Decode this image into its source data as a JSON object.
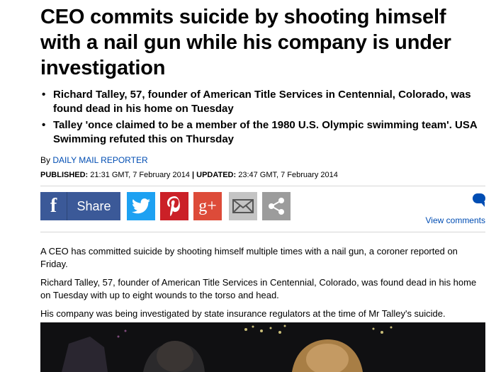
{
  "article": {
    "headline": "CEO commits suicide by shooting himself with a nail gun while his company is under investigation",
    "bullets": [
      "Richard Talley, 57, founder of American Title Services in Centennial, Colorado, was found dead in his home on Tuesday",
      "Talley 'once claimed to be a member of the 1980 U.S. Olympic swimming team'. USA Swimming refuted this on Thursday"
    ],
    "byline_prefix": "By",
    "author": "DAILY MAIL REPORTER",
    "published_label": "PUBLISHED:",
    "published_value": "21:31 GMT, 7 February 2014",
    "separator": "|",
    "updated_label": "UPDATED:",
    "updated_value": "23:47 GMT, 7 February 2014",
    "paragraphs": [
      "A CEO has committed suicide by shooting himself multiple times with a nail gun, a coroner reported on Friday.",
      "Richard Talley, 57, founder of American Title Services in Centennial, Colorado, was found dead in his home on Tuesday with up to eight wounds to the torso and head.",
      "His company was being investigated by state insurance regulators at the time of Mr Talley's suicide."
    ]
  },
  "share": {
    "facebook_label": "Share",
    "facebook_glyph": "f",
    "gplus_glyph": "g+",
    "icons": [
      "facebook-icon",
      "twitter-icon",
      "pinterest-icon",
      "google-plus-icon",
      "email-icon",
      "share-more-icon",
      "comment-bubble-icon"
    ],
    "view_comments": "View comments"
  },
  "colors": {
    "facebook": "#3b5998",
    "twitter": "#1da1f2",
    "pinterest": "#cb2027",
    "google_plus": "#dd4b39",
    "link": "#004db3"
  }
}
